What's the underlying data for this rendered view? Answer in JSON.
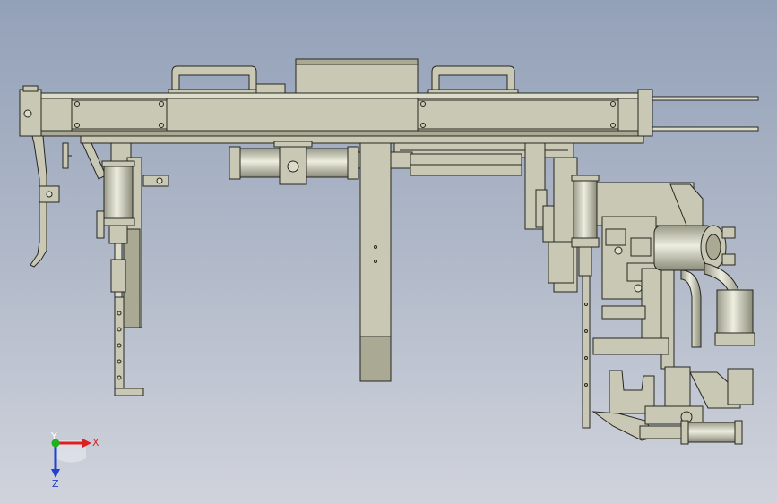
{
  "view": {
    "background_top": "#93a1b8",
    "background_bottom": "#d0d3dc",
    "part_fill": "#c8c8b4",
    "part_fill_dark": "#a9a994",
    "line_color": "#262620"
  },
  "triad": {
    "x_label": "X",
    "y_label": "Y",
    "z_label": "Z",
    "x_color": "#e02020",
    "y_color": "#20b020",
    "z_color": "#2040d0"
  }
}
